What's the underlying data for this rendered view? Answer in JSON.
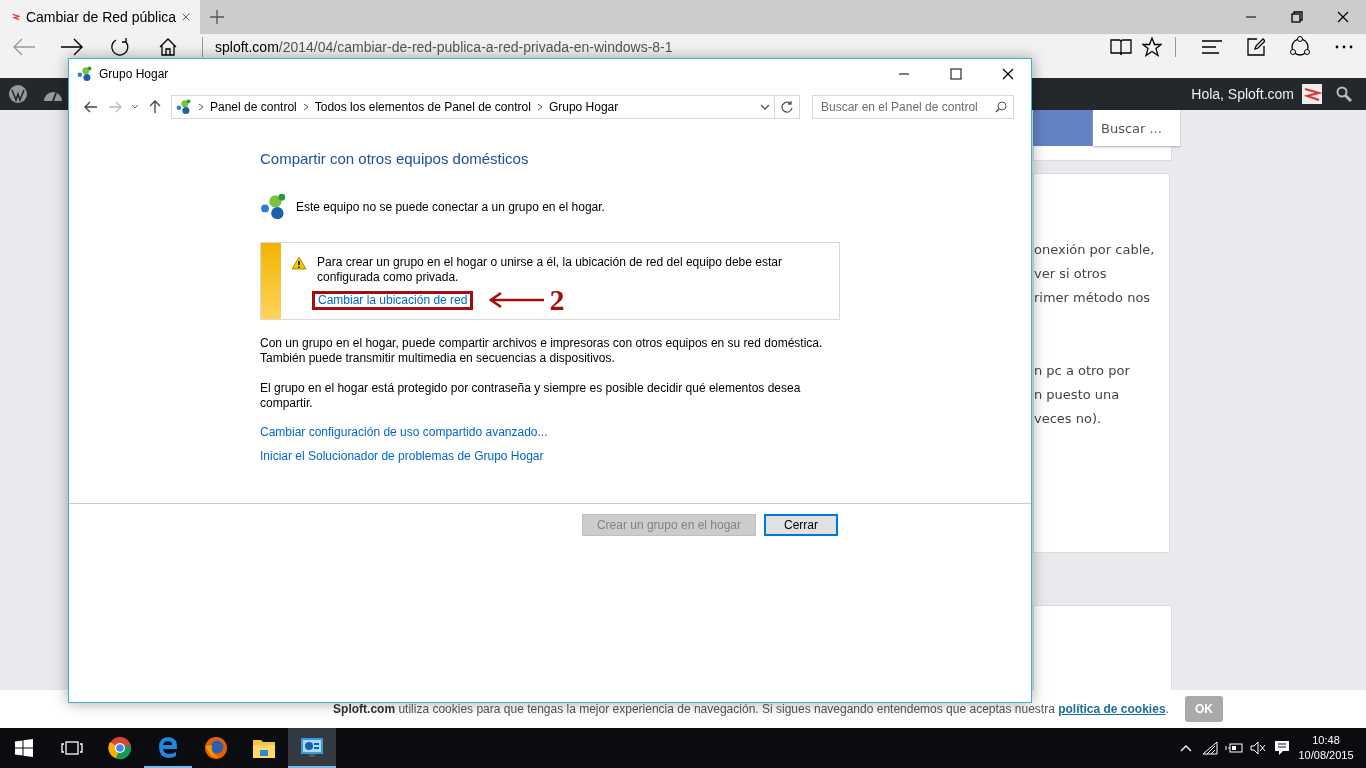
{
  "browser": {
    "tab": {
      "title": "Cambiar de Red pública"
    },
    "address": {
      "domain": "sploft.com",
      "path": "/2014/04/cambiar-de-red-publica-a-red-privada-en-windows-8-1"
    },
    "admin_bar": {
      "greeting": "Hola, Sploft.com"
    }
  },
  "page": {
    "search": {
      "placeholder": "Buscar ..."
    },
    "fragments": [
      {
        "text": "onexión por cable,"
      },
      {
        "text": "ver si otros"
      },
      {
        "text": "rimer método nos"
      },
      {
        "text": "n pc a otro por"
      },
      {
        "text": "n puesto una"
      },
      {
        "text": "veces no)."
      }
    ]
  },
  "dialog": {
    "title": "Grupo Hogar",
    "breadcrumb": [
      "Panel de control",
      "Todos los elementos de Panel de control",
      "Grupo Hogar"
    ],
    "search": {
      "placeholder": "Buscar en el Panel de control"
    },
    "heading": "Compartir con otros equipos domésticos",
    "status": "Este equipo no se puede conectar a un grupo en el hogar.",
    "warning": {
      "text": "Para crear un grupo en el hogar o unirse a él, la ubicación de red del equipo debe estar configurada como privada.",
      "link": "Cambiar la ubicación de red"
    },
    "annotation": {
      "label": "2"
    },
    "paragraphs": [
      "Con un grupo en el hogar, puede compartir archivos e impresoras con otros equipos en su red doméstica. También puede transmitir multimedia en secuencias a dispositivos.",
      "El grupo en el hogar está protegido por contraseña y siempre es posible decidir qué elementos desea compartir."
    ],
    "links": [
      "Cambiar configuración de uso compartido avanzado...",
      "Iniciar el Solucionador de problemas de Grupo Hogar"
    ],
    "buttons": [
      {
        "label": "Crear un grupo en el hogar",
        "disabled": true
      },
      {
        "label": "Cerrar",
        "disabled": false
      }
    ]
  },
  "cookie_bar": {
    "text": "**Sploft.com** utiliza cookies para que tengas la mejor experiencia de navegación. Si sigues navegando entendemos que aceptas nuestra",
    "link": "política de cookies",
    "after": ".",
    "button": "OK"
  },
  "taskbar": {
    "apps": [
      {
        "kind": "chrome",
        "open": false,
        "selected": false
      },
      {
        "kind": "edge",
        "open": true,
        "selected": false
      },
      {
        "kind": "firefox",
        "open": false,
        "selected": false
      },
      {
        "kind": "explorer",
        "open": false,
        "selected": false
      },
      {
        "kind": "control-panel",
        "open": true,
        "selected": true
      }
    ],
    "time": "10:48",
    "date": "10/08/2015"
  }
}
